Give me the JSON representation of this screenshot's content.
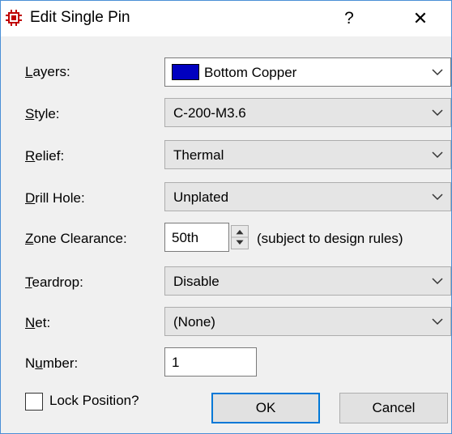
{
  "window": {
    "title": "Edit Single Pin",
    "help_label": "?",
    "close_label": "✕",
    "icon": "chip-icon"
  },
  "fields": {
    "layers": {
      "label_ul": "L",
      "label_rest": "ayers:",
      "value": "Bottom Copper",
      "swatch_color": "#0000c0"
    },
    "style": {
      "label_ul": "S",
      "label_rest": "tyle:",
      "value": "C-200-M3.6"
    },
    "relief": {
      "label_ul": "R",
      "label_rest": "elief:",
      "value": "Thermal"
    },
    "drill_hole": {
      "label_ul": "D",
      "label_rest": "rill Hole:",
      "value": "Unplated"
    },
    "zone_clearance": {
      "label_ul": "Z",
      "label_rest": "one Clearance:",
      "value": "50th",
      "note": "(subject to design rules)"
    },
    "teardrop": {
      "label_ul": "T",
      "label_rest": "eardrop:",
      "value": "Disable"
    },
    "net": {
      "label_ul": "N",
      "label_rest": "et:",
      "value": "(None)"
    },
    "number": {
      "label_pre": "N",
      "label_ul": "u",
      "label_rest": "mber:",
      "value": "1"
    }
  },
  "lock_position": {
    "label": "Lock Position?",
    "checked": false
  },
  "buttons": {
    "ok": "OK",
    "cancel": "Cancel"
  }
}
